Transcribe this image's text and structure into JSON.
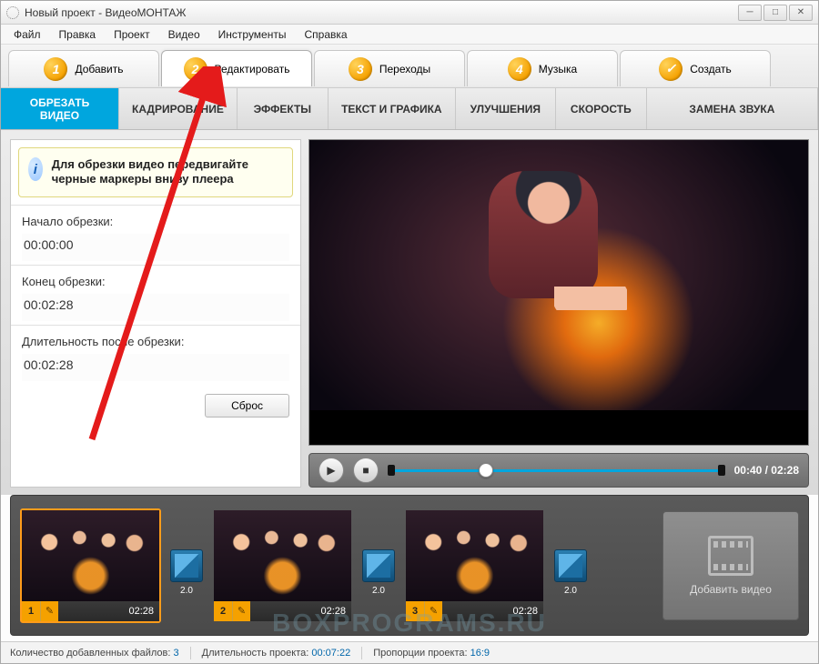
{
  "window": {
    "title": "Новый проект - ВидеоМОНТАЖ"
  },
  "menu": {
    "file": "Файл",
    "edit": "Правка",
    "project": "Проект",
    "video": "Видео",
    "tools": "Инструменты",
    "help": "Справка"
  },
  "steps": {
    "s1": "Добавить",
    "s2": "Редактировать",
    "s3": "Переходы",
    "s4": "Музыка",
    "s5": "Создать"
  },
  "subtabs": {
    "trim": "ОБРЕЗАТЬ ВИДЕО",
    "crop": "КАДРИРОВАНИЕ",
    "fx": "ЭФФЕКТЫ",
    "text": "ТЕКСТ И ГРАФИКА",
    "enh": "УЛУЧШЕНИЯ",
    "speed": "СКОРОСТЬ",
    "audio": "ЗАМЕНА ЗВУКА"
  },
  "trim": {
    "hint": "Для обрезки видео передвигайте черные маркеры внизу плеера",
    "start_label": "Начало обрезки:",
    "start": "00:00:00",
    "end_label": "Конец обрезки:",
    "end": "00:02:28",
    "len_label": "Длительность после обрезки:",
    "len": "00:02:28",
    "reset": "Сброс"
  },
  "player": {
    "time": "00:40 / 02:28",
    "knob_pct": 27
  },
  "timeline": {
    "clips": [
      {
        "n": "1",
        "dur": "02:28"
      },
      {
        "n": "2",
        "dur": "02:28"
      },
      {
        "n": "3",
        "dur": "02:28"
      }
    ],
    "trans": "2.0",
    "add": "Добавить видео"
  },
  "status": {
    "files_label": "Количество добавленных файлов:",
    "files": "3",
    "len_label": "Длительность проекта:",
    "len": "00:07:22",
    "aspect_label": "Пропорции проекта:",
    "aspect": "16:9"
  },
  "watermark": "BOXPROGRAMS.RU"
}
